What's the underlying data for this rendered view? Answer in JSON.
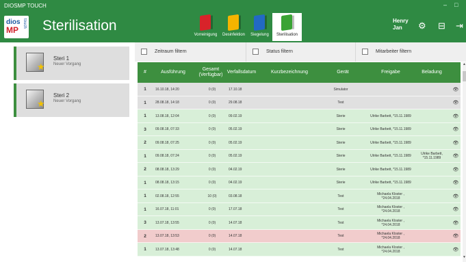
{
  "window": {
    "title": "DIOSMP TOUCH",
    "minimize": "–",
    "maximize": "□"
  },
  "logo": {
    "line1": "dios",
    "line2": "MP",
    "line3": "touch"
  },
  "header": {
    "title": "Sterilisation",
    "tabs": [
      {
        "label": "Vorreinigung",
        "color": "#d8232a"
      },
      {
        "label": "Desinfektion",
        "color": "#f5b400"
      },
      {
        "label": "Siegelung",
        "color": "#2269c4"
      },
      {
        "label": "Sterilisation",
        "color": "#3aa334"
      }
    ],
    "user": {
      "first": "Henry",
      "last": "Jan"
    },
    "icons": [
      "gear-icon",
      "exit-icon",
      "logout-icon"
    ]
  },
  "left_panel": {
    "cards": [
      {
        "name": "Steri 1",
        "status": "Neuer Vorgang"
      },
      {
        "name": "Steri 2",
        "status": "Neuer Vorgang"
      }
    ]
  },
  "filters": [
    "Zeitraum filtern",
    "Status filtern",
    "Mitarbeiter filtern"
  ],
  "table": {
    "headers": {
      "num": "#",
      "ausfuehrung": "Ausführung",
      "gesamt": "Gesamt (Verfügbar)",
      "verfall": "Verfallsdatum",
      "kurz": "Kurzbezeichnung",
      "geraet": "Gerät",
      "freigabe": "Freigabe",
      "beladung": "Beladung"
    },
    "rows": [
      {
        "num": "1",
        "ausf": "16.10.18, 14:20",
        "gesamt": "0 (0)",
        "verf": "17.10.18",
        "kurz": "",
        "geraet": "Simulator",
        "frei": "",
        "bel": "",
        "status": "grey"
      },
      {
        "num": "1",
        "ausf": "28.08.18, 14:18",
        "gesamt": "0 (0)",
        "verf": "29.08.18",
        "kurz": "",
        "geraet": "Test",
        "frei": "",
        "bel": "",
        "status": "grey"
      },
      {
        "num": "1",
        "ausf": "13.08.18, 12:04",
        "gesamt": "0 (0)",
        "verf": "09.02.19",
        "kurz": "",
        "geraet": "Sterie",
        "frei": "Ulrike Barbett, *15.11.1989",
        "bel": "",
        "status": "green"
      },
      {
        "num": "3",
        "ausf": "09.08.18, 07:33",
        "gesamt": "0 (0)",
        "verf": "05.02.19",
        "kurz": "",
        "geraet": "Sterie",
        "frei": "Ulrike Barbett, *15.11.1989",
        "bel": "",
        "status": "green"
      },
      {
        "num": "2",
        "ausf": "09.08.18, 07:25",
        "gesamt": "0 (0)",
        "verf": "05.02.19",
        "kurz": "",
        "geraet": "Sterie",
        "frei": "Ulrike Barbett, *15.11.1989",
        "bel": "",
        "status": "green"
      },
      {
        "num": "1",
        "ausf": "09.08.18, 07:24",
        "gesamt": "0 (0)",
        "verf": "05.02.19",
        "kurz": "",
        "geraet": "Sterie",
        "frei": "Ulrike Barbett, *15.11.1989",
        "bel": "Ulrike Barbett, *15.11.1989",
        "status": "green"
      },
      {
        "num": "2",
        "ausf": "08.08.18, 13:29",
        "gesamt": "0 (0)",
        "verf": "04.02.19",
        "kurz": "",
        "geraet": "Sterie",
        "frei": "Ulrike Barbett, *15.11.1989",
        "bel": "",
        "status": "green"
      },
      {
        "num": "1",
        "ausf": "08.08.18, 13:15",
        "gesamt": "0 (0)",
        "verf": "04.02.19",
        "kurz": "",
        "geraet": "Sterie",
        "frei": "Ulrike Barbett, *15.11.1989",
        "bel": "",
        "status": "green"
      },
      {
        "num": "1",
        "ausf": "02.08.18, 12:55",
        "gesamt": "10 (0)",
        "verf": "03.08.18",
        "kurz": "",
        "geraet": "Test",
        "frei": "Michaela Kloster , *24.04.2018",
        "bel": "",
        "status": "green"
      },
      {
        "num": "1",
        "ausf": "16.07.18, 11:01",
        "gesamt": "0 (0)",
        "verf": "17.07.18",
        "kurz": "",
        "geraet": "Test",
        "frei": "Michaela Kloster , *24.04.2018",
        "bel": "",
        "status": "green"
      },
      {
        "num": "3",
        "ausf": "13.07.18, 13:55",
        "gesamt": "0 (0)",
        "verf": "14.07.18",
        "kurz": "",
        "geraet": "Test",
        "frei": "Michaela Kloster , *24.04.2018",
        "bel": "",
        "status": "green"
      },
      {
        "num": "2",
        "ausf": "13.07.18, 13:53",
        "gesamt": "0 (0)",
        "verf": "14.07.18",
        "kurz": "",
        "geraet": "Test",
        "frei": "Michaela Kloster , *24.04.2018",
        "bel": "",
        "status": "red"
      },
      {
        "num": "1",
        "ausf": "13.07.18, 13:48",
        "gesamt": "0 (0)",
        "verf": "14.07.18",
        "kurz": "",
        "geraet": "Test",
        "frei": "Michaela Kloster , *24.04.2018",
        "bel": "",
        "status": "green"
      }
    ]
  },
  "colors": {
    "brand_green": "#2f8a43",
    "table_header": "#3d8f3f",
    "row_ok": "#d8efd8",
    "row_error": "#f1cccc",
    "row_neutral": "#e0e0e0"
  }
}
